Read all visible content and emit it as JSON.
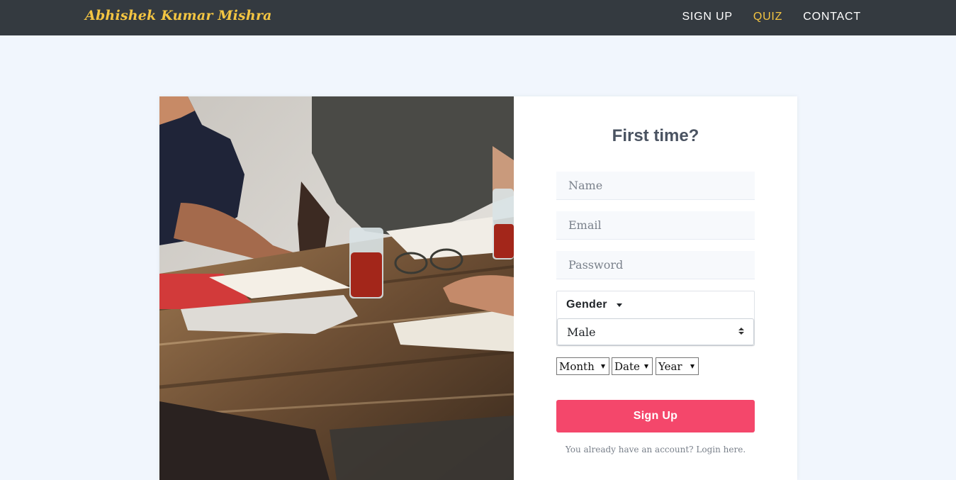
{
  "navbar": {
    "brand": "Abhishek Kumar Mishra",
    "links": [
      {
        "label": "SIGN UP"
      },
      {
        "label": "QUIZ"
      },
      {
        "label": "CONTACT"
      }
    ],
    "active_link": "QUIZ",
    "accent_color": "#f4c542",
    "background_color": "#343a40"
  },
  "hero_image": {
    "description_icon": "people-at-table-photo"
  },
  "form": {
    "title": "First time?",
    "name_placeholder": "Name",
    "email_placeholder": "Email",
    "password_placeholder": "Password",
    "gender": {
      "label": "Gender",
      "selected": "Male"
    },
    "dob": {
      "month": "Month",
      "date": "Date",
      "year": "Year"
    },
    "submit_label": "Sign Up",
    "submit_color": "#f4476b",
    "login_text": "You already have an account? Login here."
  }
}
